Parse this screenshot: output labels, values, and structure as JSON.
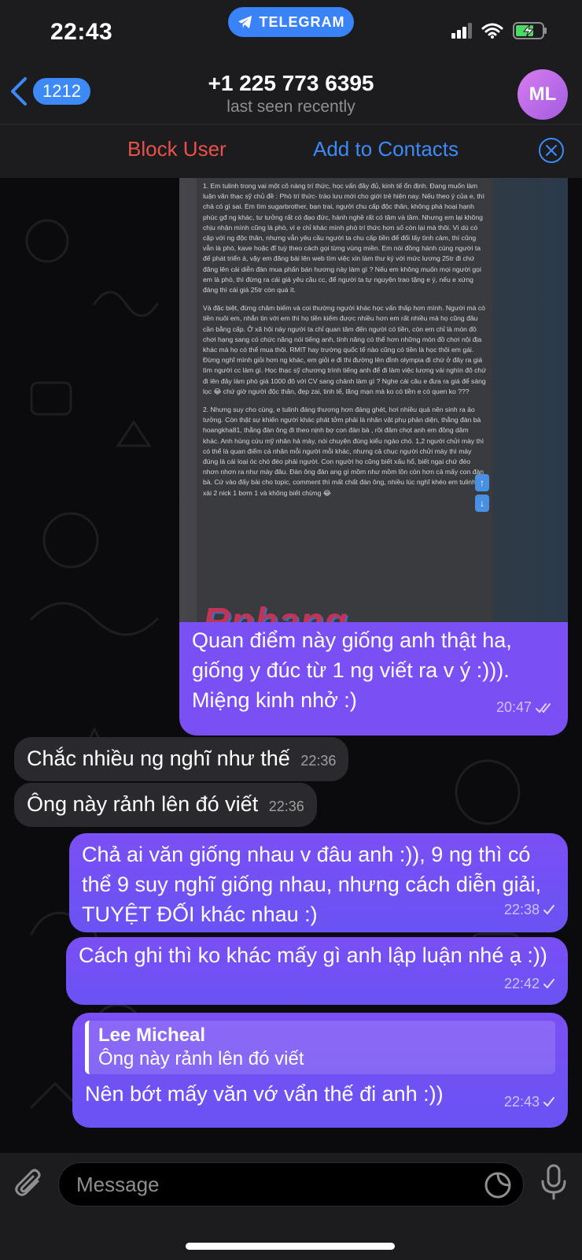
{
  "status_bar": {
    "time": "22:43",
    "app_pill": "TELEGRAM",
    "icons": [
      "signal-icon",
      "wifi-icon",
      "battery-charging-icon"
    ]
  },
  "header": {
    "back_count": "1212",
    "title": "+1 225 773 6395",
    "subtitle": "last seen recently",
    "avatar_initials": "ML"
  },
  "actions": {
    "block": "Block User",
    "add": "Add to Contacts"
  },
  "image_message": {
    "doc_paragraphs": [
      "1. Em tulinh trong vai một cô nàng trí thức, học vấn đầy đủ, kinh tế ổn định. Đang muốn làm luận văn thạc sỹ chủ đề : Phò trí thức- trào lưu mới cho giới trẻ hiện nay. Nếu theo ý của e, thì chả có gì sai. Em tìm sugarbrother, bạn trai, người chu cấp độc thân, không phá hoại hạnh phúc gđ ng khác, tư tưởng rất có đạo đức, hành nghề rất có tâm và tầm. Nhưng em lại không chịu nhận mình cũng là phò, vì e chỉ khác mình phò trí thức hơn số còn lại mà thôi. Vì dù có cặp với ng độc thân, nhưng vẫn yêu cầu người ta chu cấp tiền để đổi lấy tình cảm, thì cũng vẫn là phò, kave hoặc đĩ tuỳ theo cách gọi từng vùng miền. Em nói đồng hành cùng người ta để phát triển á, vậy em đăng bài lên web tìm việc xin làm thư ký với mức lương 25tr đi chứ đăng lên cái diễn đàn mua phấn bán hương này làm gì ? Nếu em không muốn mọi người gọi em là phò, thì đừng ra cái giá yêu cầu cc, để người ta tự nguyện trao tặng e ý, nếu e xứng đáng thì cái giá 25tr còn quá ít.",
      "Và đặc biệt, đừng châm biếm và coi thường người khác học vấn thấp hơn mình. Người mà có tiền nuôi em, nhắn tin với em thì họ tiền kiếm được nhiều hơn em rất nhiều mà họ cũng đâu cần bằng cấp. Ở xã hội này người ta chỉ quan tâm đến người có tiền, còn em chỉ là món đồ chơi hạng sang có chức năng nói tiếng anh, tính năng có thể hơn những món đồ chơi nội địa khác mà họ có thể mua thôi. RMIT hay trường quốc tế nào cũng có tiền là học thôi em gái. Đừng nghĩ mình giỏi hơn ng khác, em giỏi e đi thi đường lên đỉnh olympia đi chứ ở đây ra giá tìm người cc làm gì. Học thạc sỹ chương trình tiếng anh để đi làm việc lương vài nghìn đô chứ đi lên đây làm phò giá 1000 đô với CV sang chảnh làm gì ? Nghe cái câu e đưa ra giá để sàng lọc 😂 chứ giờ người độc thân, đẹp zai, tinh tế, lãng mạn mà ko có tiền e có quen ko ???",
      "2. Nhưng suy cho cùng, e tulinh đáng thương hơn đáng ghét, hơi nhiều quá nên sinh ra ảo tưởng. Còn thật sự khiến người khác phát tởm phải là nhân vật phụ phản diện, thằng đàn bà hoangkha81, thằng đàn ông đi theo nịnh bợ con đàn bà , rồi đâm chọt anh em đồng dâm khác. Anh hùng cứu mỹ nhân hả mày, nói chuyện đúng kiểu ngáo chó. 1,2 người chửi mày thì có thể là quan điểm cá nhân mỗi người mỗi khác, nhưng cả chục người chửi mày thì mày đúng là cái loại óc chó đéo phải người. Con người họ cũng biết xấu hổ, biết ngại chứ đéo nhơn nhơn ra như mày đâu. Đàn ông đàn ang gì mồm như mồm lồn còn hơn cả mấy con đàn bà. Cứ vào đấy bài cho topic, comment thì mất chất đàn ông, nhiều lúc nghĩ khéo em tulinh xài 2 nick 1 bơm 1 và không biết chừng 😂"
    ],
    "watermark": "Rphang",
    "caption": "Quan điểm này giống anh thật ha, giống y đúc từ 1 ng viết ra v ý :))). Miệng kinh nhở :)",
    "time": "20:47"
  },
  "messages": [
    {
      "text": "Chắc nhiều ng nghĩ như thế",
      "time": "22:36"
    },
    {
      "text": "Ông này rảnh lên đó viết",
      "time": "22:36"
    },
    {
      "text": "Chả ai văn giống nhau v đâu anh :)), 9 ng thì có thể 9 suy nghĩ giống nhau, nhưng cách diễn giải, TUYỆT ĐỐI khác nhau :)",
      "time": "22:38"
    },
    {
      "text": "Cách ghi thì ko khác mấy gì anh lập luận nhé ạ :))",
      "time": "22:42"
    },
    {
      "reply_name": "Lee Micheal",
      "reply_text": "Ông này rảnh lên đó viết",
      "text": "Nên bớt mấy văn vớ vẩn thế đi anh :))",
      "time": "22:43"
    }
  ],
  "input": {
    "placeholder": "Message"
  },
  "colors": {
    "accent": "#3d8af7",
    "danger": "#e8524a",
    "outgoing_bubble": "#7a4ff4",
    "incoming_bubble": "#2a2a2e"
  }
}
